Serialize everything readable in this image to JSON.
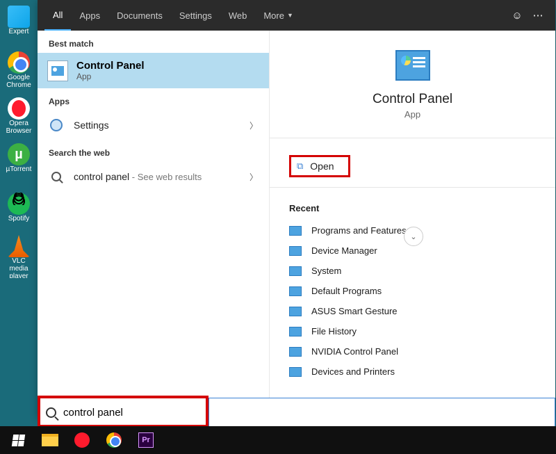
{
  "desktop_icons": [
    {
      "name": "edge",
      "label": "Expert"
    },
    {
      "name": "chrome",
      "label": "Google Chrome"
    },
    {
      "name": "opera",
      "label": "Opera Browser"
    },
    {
      "name": "utorrent",
      "label": "µTorrent"
    },
    {
      "name": "spotify",
      "label": "Spotify"
    },
    {
      "name": "vlc",
      "label": "VLC media player"
    }
  ],
  "tabs": {
    "all": "All",
    "apps": "Apps",
    "documents": "Documents",
    "settings": "Settings",
    "web": "Web",
    "more": "More"
  },
  "left": {
    "best_match_h": "Best match",
    "best_title": "Control Panel",
    "best_sub": "App",
    "apps_h": "Apps",
    "settings_label": "Settings",
    "searchweb_h": "Search the web",
    "web_query": "control panel",
    "web_suffix": " - See web results"
  },
  "right": {
    "title": "Control Panel",
    "sub": "App",
    "open": "Open",
    "recent_h": "Recent",
    "recent": [
      "Programs and Features",
      "Device Manager",
      "System",
      "Default Programs",
      "ASUS Smart Gesture",
      "File History",
      "NVIDIA Control Panel",
      "Devices and Printers"
    ]
  },
  "search_value": "control panel"
}
